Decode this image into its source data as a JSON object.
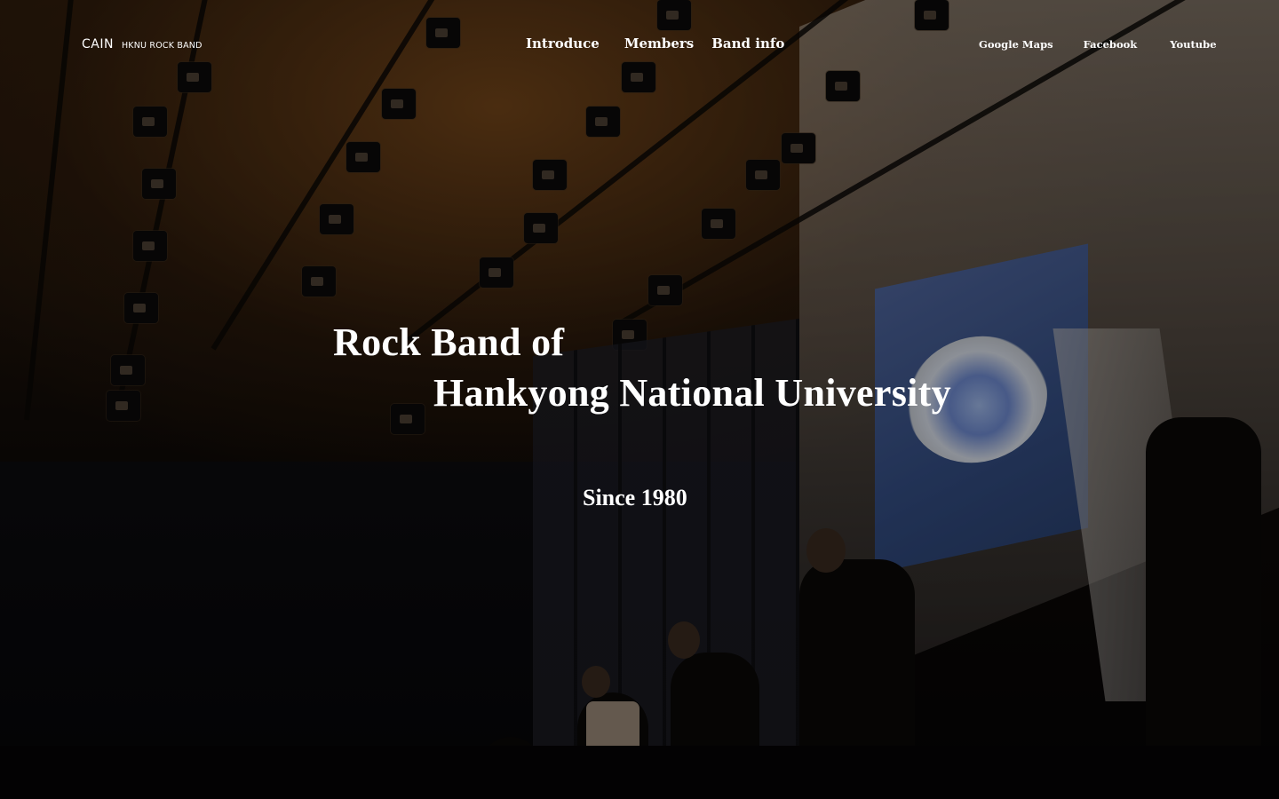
{
  "brand": {
    "name": "CAIN",
    "subtitle": "HKNU ROCK BAND"
  },
  "nav": {
    "main": [
      {
        "label": "Introduce"
      },
      {
        "label": "Members"
      },
      {
        "label": "Band info"
      }
    ],
    "external": [
      {
        "label": "Google Maps"
      },
      {
        "label": "Facebook"
      },
      {
        "label": "Youtube"
      }
    ]
  },
  "hero": {
    "headline_line1": "Rock Band of",
    "headline_line2": "Hankyong National University",
    "since": "Since 1980"
  },
  "colors": {
    "text": "#ffffff",
    "background_warm": "#2a1a0c",
    "background_dark": "#050405"
  }
}
